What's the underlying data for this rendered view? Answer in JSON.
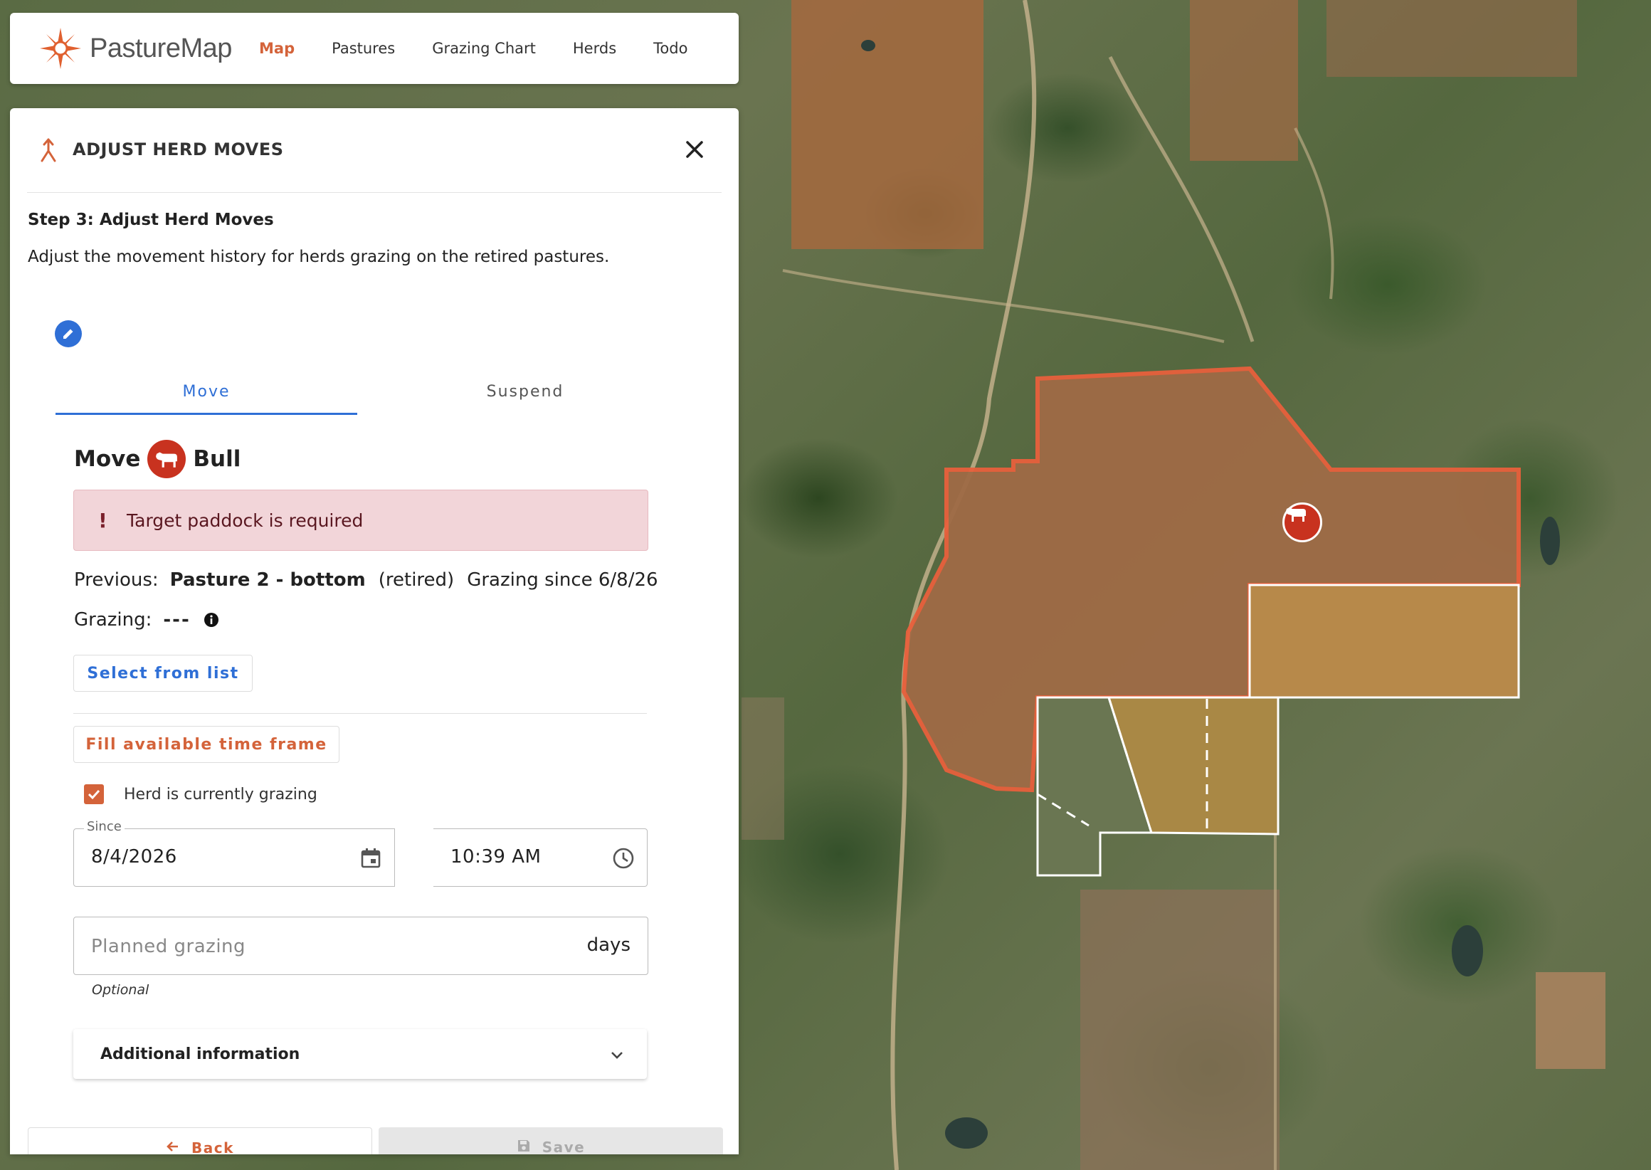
{
  "nav": {
    "brand": "PastureMap",
    "links": [
      {
        "label": "Map",
        "active": true
      },
      {
        "label": "Pastures",
        "active": false
      },
      {
        "label": "Grazing Chart",
        "active": false
      },
      {
        "label": "Herds",
        "active": false
      },
      {
        "label": "Todo",
        "active": false
      }
    ]
  },
  "panel": {
    "title": "ADJUST HERD MOVES",
    "step_title": "Step 3: Adjust Herd Moves",
    "step_desc": "Adjust the movement history for herds grazing on the retired pastures.",
    "tabs": [
      {
        "label": "Move",
        "active": true
      },
      {
        "label": "Suspend",
        "active": false
      }
    ],
    "move": {
      "prefix": "Move",
      "herd_name": "Bull"
    },
    "alert": {
      "mark": "!",
      "text": "Target paddock is required"
    },
    "previous": {
      "label": "Previous:",
      "pasture": "Pasture 2 - bottom",
      "status": "(retired)",
      "since": "Grazing since 6/8/26"
    },
    "grazing": {
      "label": "Grazing:",
      "value": "---"
    },
    "select_button": "Select from list",
    "fill_button": "Fill available time frame",
    "currently_grazing": {
      "label": "Herd is currently grazing",
      "checked": true
    },
    "since": {
      "label": "Since",
      "date": "8/4/2026",
      "time": "10:39 AM"
    },
    "planned": {
      "placeholder": "Planned grazing",
      "suffix": "days",
      "hint": "Optional"
    },
    "additional_info": "Additional information",
    "back_button": "Back",
    "save_button": "Save"
  },
  "colors": {
    "accent": "#d4633a",
    "primary_blue": "#2f6fd6",
    "herd_red": "#c8321f",
    "alert_bg": "#f2d5d9",
    "paddock_outline": "#e8603c"
  }
}
